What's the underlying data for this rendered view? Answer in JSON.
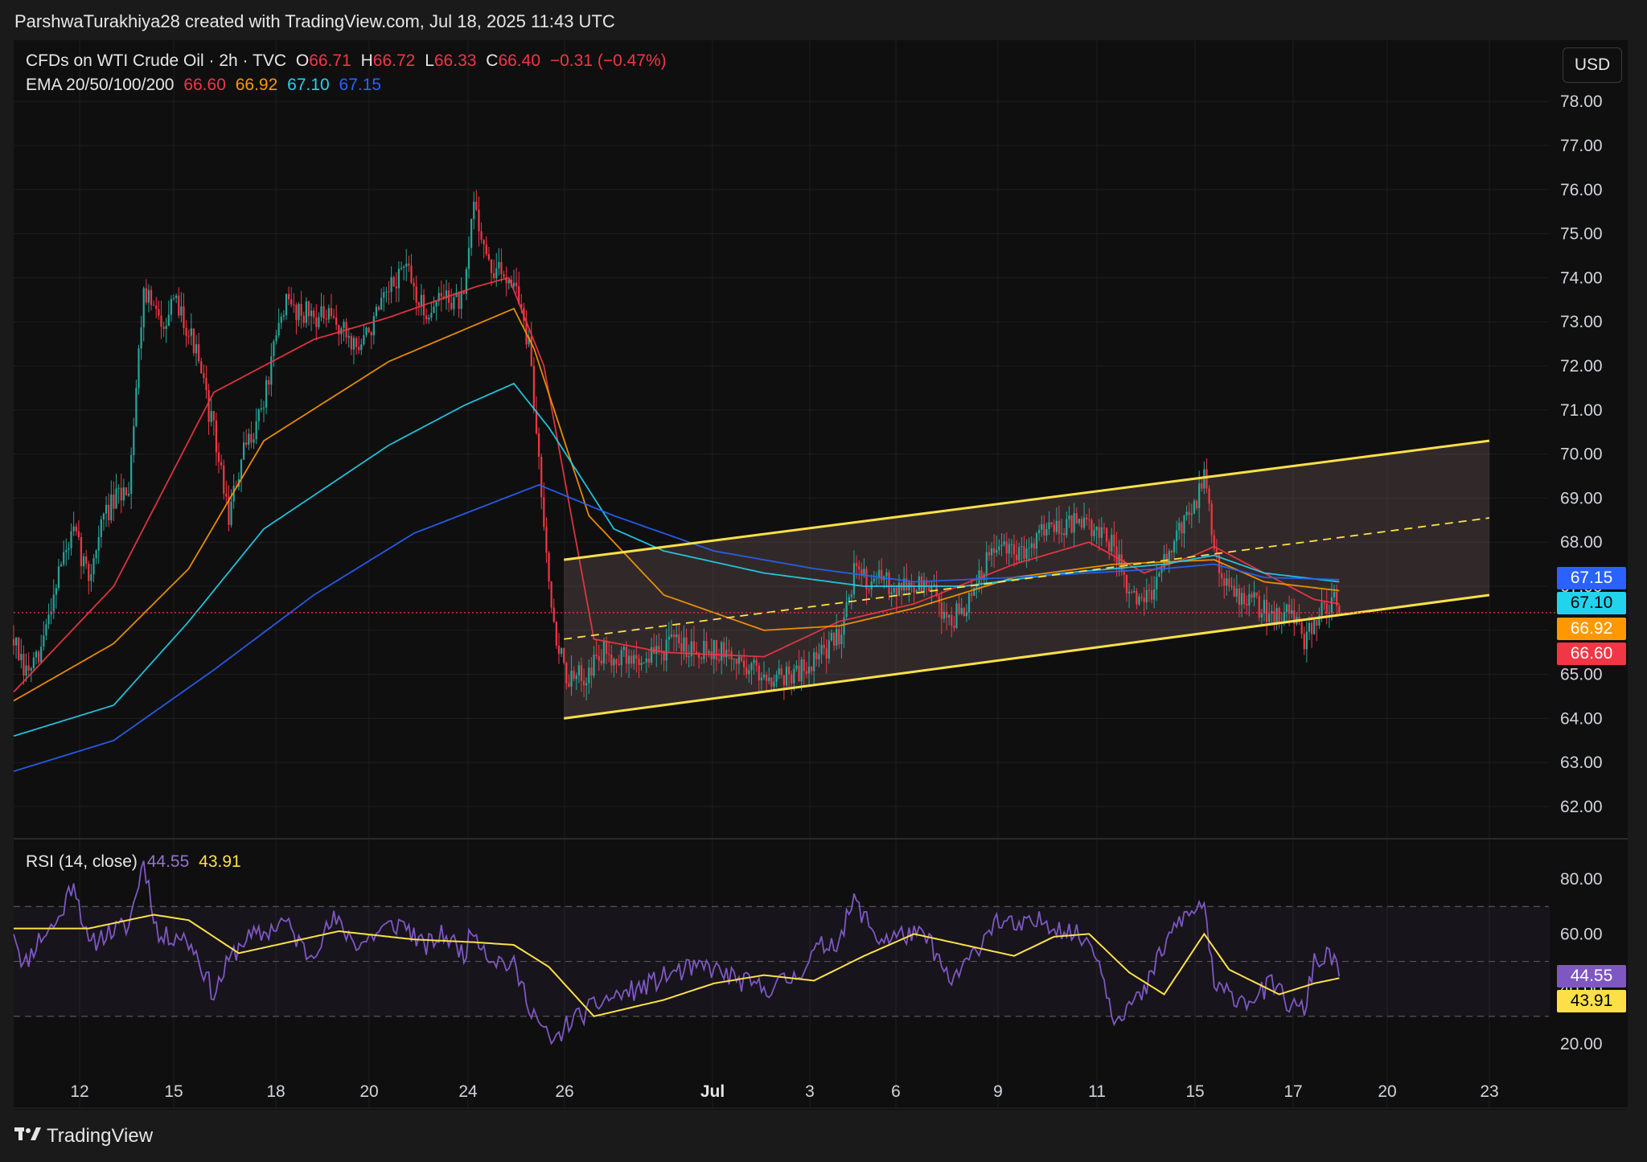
{
  "header": {
    "attribution": "ParshwaTurakhiya28 created with TradingView.com, Jul 18, 2025 11:43 UTC"
  },
  "legend": {
    "symbol": "CFDs on WTI Crude Oil · 2h · TVC",
    "o_label": "O",
    "o_value": "66.71",
    "h_label": "H",
    "h_value": "66.72",
    "l_label": "L",
    "l_value": "66.33",
    "c_label": "C",
    "c_value": "66.40",
    "change": "−0.31 (−0.47%)",
    "ema_label": "EMA 20/50/100/200",
    "ema20": "66.60",
    "ema50": "66.92",
    "ema100": "67.10",
    "ema200": "67.15",
    "rsi_label": "RSI (14, close)",
    "rsi_value": "44.55",
    "rsi_ma": "43.91"
  },
  "currency_button": "USD",
  "price_tags": {
    "ema200": "67.15",
    "ema100": "67.10",
    "ema50": "66.92",
    "ema20": "66.60",
    "rsi": "44.55",
    "rsi_ma": "43.91"
  },
  "footer": {
    "brand": "TradingView"
  },
  "colors": {
    "up": "#26a69a",
    "down": "#f23645",
    "ema20": "#f23645",
    "ema50": "#ff9800",
    "ema100": "#22d3ee",
    "ema200": "#2962ff",
    "channel": "#fde047",
    "rsi": "#7e57c2",
    "rsi_ma": "#fde047",
    "bg": "#0f0f0f"
  },
  "chart_data": [
    {
      "type": "candlestick",
      "title": "CFDs on WTI Crude Oil · 2h · TVC",
      "x_ticks": [
        "12",
        "15",
        "18",
        "20",
        "24",
        "26",
        "Jul",
        "3",
        "6",
        "9",
        "11",
        "15",
        "17",
        "20",
        "23"
      ],
      "y_ticks": [
        "62.00",
        "63.00",
        "64.00",
        "65.00",
        "66.00",
        "67.00",
        "68.00",
        "69.00",
        "70.00",
        "71.00",
        "72.00",
        "73.00",
        "74.00",
        "75.00",
        "76.00",
        "77.00",
        "78.00"
      ],
      "ylim": [
        61.3,
        78.8
      ],
      "last_close": 66.4,
      "price_anchors": [
        [
          0,
          65.8
        ],
        [
          4,
          65.0
        ],
        [
          10,
          65.3
        ],
        [
          18,
          67.4
        ],
        [
          24,
          68.2
        ],
        [
          30,
          67.2
        ],
        [
          36,
          68.6
        ],
        [
          46,
          69.3
        ],
        [
          52,
          73.8
        ],
        [
          58,
          73.0
        ],
        [
          66,
          73.4
        ],
        [
          72,
          72.5
        ],
        [
          80,
          70.5
        ],
        [
          86,
          68.6
        ],
        [
          92,
          70.0
        ],
        [
          100,
          71.2
        ],
        [
          108,
          73.4
        ],
        [
          118,
          73.2
        ],
        [
          128,
          73.0
        ],
        [
          138,
          72.4
        ],
        [
          148,
          73.4
        ],
        [
          156,
          74.3
        ],
        [
          164,
          73.2
        ],
        [
          172,
          73.6
        ],
        [
          180,
          73.4
        ],
        [
          184,
          75.8
        ],
        [
          190,
          74.2
        ],
        [
          200,
          74.0
        ],
        [
          206,
          72.4
        ],
        [
          212,
          68.6
        ],
        [
          216,
          66.0
        ],
        [
          222,
          64.8
        ],
        [
          228,
          65.0
        ],
        [
          236,
          65.5
        ],
        [
          250,
          65.3
        ],
        [
          264,
          65.7
        ],
        [
          278,
          65.6
        ],
        [
          290,
          65.3
        ],
        [
          300,
          65.0
        ],
        [
          312,
          65.0
        ],
        [
          322,
          65.4
        ],
        [
          330,
          65.9
        ],
        [
          336,
          67.3
        ],
        [
          346,
          67.1
        ],
        [
          358,
          67.0
        ],
        [
          366,
          67.0
        ],
        [
          374,
          66.2
        ],
        [
          382,
          66.6
        ],
        [
          392,
          67.9
        ],
        [
          402,
          67.7
        ],
        [
          412,
          68.4
        ],
        [
          424,
          68.4
        ],
        [
          432,
          68.3
        ],
        [
          440,
          67.9
        ],
        [
          446,
          66.7
        ],
        [
          452,
          66.7
        ],
        [
          458,
          67.2
        ],
        [
          466,
          68.3
        ],
        [
          472,
          68.8
        ],
        [
          476,
          69.5
        ],
        [
          480,
          67.9
        ],
        [
          486,
          66.9
        ],
        [
          494,
          66.7
        ],
        [
          504,
          66.3
        ],
        [
          510,
          66.6
        ],
        [
          516,
          65.6
        ],
        [
          520,
          66.3
        ],
        [
          528,
          66.7
        ],
        [
          530,
          66.4
        ]
      ],
      "series": [
        {
          "name": "EMA 20",
          "anchors": [
            [
              0,
              64.6
            ],
            [
              40,
              67.0
            ],
            [
              80,
              71.4
            ],
            [
              120,
              72.6
            ],
            [
              150,
              73.1
            ],
            [
              185,
              73.8
            ],
            [
              198,
              74.0
            ],
            [
              212,
              72.0
            ],
            [
              232,
              65.8
            ],
            [
              260,
              65.5
            ],
            [
              300,
              65.4
            ],
            [
              330,
              66.2
            ],
            [
              360,
              66.6
            ],
            [
              400,
              67.5
            ],
            [
              430,
              68.0
            ],
            [
              452,
              67.3
            ],
            [
              472,
              67.7
            ],
            [
              480,
              67.9
            ],
            [
              520,
              66.7
            ],
            [
              530,
              66.6
            ]
          ]
        },
        {
          "name": "EMA 50",
          "anchors": [
            [
              0,
              64.4
            ],
            [
              40,
              65.7
            ],
            [
              70,
              67.4
            ],
            [
              100,
              70.3
            ],
            [
              150,
              72.1
            ],
            [
              200,
              73.3
            ],
            [
              208,
              72.4
            ],
            [
              230,
              68.6
            ],
            [
              260,
              66.8
            ],
            [
              300,
              66.0
            ],
            [
              330,
              66.1
            ],
            [
              360,
              66.5
            ],
            [
              400,
              67.2
            ],
            [
              440,
              67.5
            ],
            [
              480,
              67.6
            ],
            [
              500,
              67.1
            ],
            [
              530,
              66.9
            ]
          ]
        },
        {
          "name": "EMA 100",
          "anchors": [
            [
              0,
              63.6
            ],
            [
              40,
              64.3
            ],
            [
              70,
              66.2
            ],
            [
              100,
              68.3
            ],
            [
              150,
              70.2
            ],
            [
              180,
              71.1
            ],
            [
              200,
              71.6
            ],
            [
              214,
              70.6
            ],
            [
              240,
              68.3
            ],
            [
              260,
              67.8
            ],
            [
              300,
              67.3
            ],
            [
              340,
              67.0
            ],
            [
              380,
              67.0
            ],
            [
              420,
              67.3
            ],
            [
              460,
              67.5
            ],
            [
              480,
              67.7
            ],
            [
              500,
              67.3
            ],
            [
              530,
              67.1
            ]
          ]
        },
        {
          "name": "EMA 200",
          "anchors": [
            [
              0,
              62.8
            ],
            [
              40,
              63.5
            ],
            [
              80,
              65.1
            ],
            [
              120,
              66.8
            ],
            [
              160,
              68.2
            ],
            [
              210,
              69.3
            ],
            [
              240,
              68.6
            ],
            [
              280,
              67.8
            ],
            [
              320,
              67.4
            ],
            [
              360,
              67.1
            ],
            [
              400,
              67.2
            ],
            [
              430,
              67.3
            ],
            [
              460,
              67.4
            ],
            [
              480,
              67.5
            ],
            [
              500,
              67.2
            ],
            [
              530,
              67.15
            ]
          ]
        }
      ],
      "channel": {
        "upper": [
          [
            220,
            67.6
          ],
          [
            590,
            70.3
          ]
        ],
        "lower": [
          [
            220,
            64.0
          ],
          [
            590,
            66.8
          ]
        ],
        "mid": [
          [
            220,
            65.8
          ],
          [
            590,
            68.55
          ]
        ]
      }
    },
    {
      "type": "line",
      "title": "RSI (14, close)",
      "y_ticks": [
        "20.00",
        "40.00",
        "60.00",
        "80.00"
      ],
      "ylim": [
        12,
        92
      ],
      "bands": [
        30,
        50,
        70
      ],
      "series": [
        {
          "name": "RSI",
          "anchors": [
            [
              0,
              62
            ],
            [
              4,
              48
            ],
            [
              10,
              58
            ],
            [
              18,
              65
            ],
            [
              24,
              80
            ],
            [
              30,
              55
            ],
            [
              36,
              60
            ],
            [
              46,
              63
            ],
            [
              52,
              87
            ],
            [
              58,
              58
            ],
            [
              66,
              60
            ],
            [
              72,
              55
            ],
            [
              80,
              38
            ],
            [
              86,
              50
            ],
            [
              92,
              58
            ],
            [
              100,
              60
            ],
            [
              108,
              65
            ],
            [
              118,
              52
            ],
            [
              128,
              65
            ],
            [
              138,
              56
            ],
            [
              148,
              62
            ],
            [
              156,
              64
            ],
            [
              164,
              55
            ],
            [
              172,
              60
            ],
            [
              180,
              53
            ],
            [
              184,
              62
            ],
            [
              190,
              52
            ],
            [
              200,
              48
            ],
            [
              206,
              35
            ],
            [
              212,
              24
            ],
            [
              216,
              20
            ],
            [
              222,
              28
            ],
            [
              228,
              31
            ],
            [
              236,
              36
            ],
            [
              250,
              40
            ],
            [
              264,
              46
            ],
            [
              278,
              48
            ],
            [
              290,
              43
            ],
            [
              300,
              40
            ],
            [
              312,
              44
            ],
            [
              322,
              55
            ],
            [
              330,
              58
            ],
            [
              336,
              72
            ],
            [
              346,
              58
            ],
            [
              358,
              60
            ],
            [
              366,
              58
            ],
            [
              374,
              42
            ],
            [
              382,
              50
            ],
            [
              392,
              65
            ],
            [
              402,
              62
            ],
            [
              412,
              65
            ],
            [
              424,
              60
            ],
            [
              432,
              56
            ],
            [
              440,
              30
            ],
            [
              446,
              34
            ],
            [
              452,
              38
            ],
            [
              458,
              52
            ],
            [
              466,
              65
            ],
            [
              472,
              68
            ],
            [
              476,
              72
            ],
            [
              480,
              40
            ],
            [
              486,
              38
            ],
            [
              494,
              36
            ],
            [
              504,
              42
            ],
            [
              510,
              34
            ],
            [
              516,
              32
            ],
            [
              520,
              50
            ],
            [
              528,
              52
            ],
            [
              530,
              46
            ]
          ]
        },
        {
          "name": "RSI MA",
          "anchors": [
            [
              0,
              62
            ],
            [
              30,
              62
            ],
            [
              56,
              67
            ],
            [
              70,
              65
            ],
            [
              90,
              53
            ],
            [
              105,
              56
            ],
            [
              130,
              61
            ],
            [
              160,
              58
            ],
            [
              184,
              57
            ],
            [
              200,
              56
            ],
            [
              214,
              48
            ],
            [
              232,
              30
            ],
            [
              260,
              36
            ],
            [
              280,
              42
            ],
            [
              300,
              45
            ],
            [
              320,
              43
            ],
            [
              340,
              52
            ],
            [
              360,
              60
            ],
            [
              380,
              56
            ],
            [
              400,
              52
            ],
            [
              416,
              59
            ],
            [
              430,
              60
            ],
            [
              446,
              46
            ],
            [
              460,
              38
            ],
            [
              476,
              60
            ],
            [
              486,
              47
            ],
            [
              506,
              38
            ],
            [
              520,
              42
            ],
            [
              530,
              43.9
            ]
          ]
        }
      ]
    }
  ]
}
